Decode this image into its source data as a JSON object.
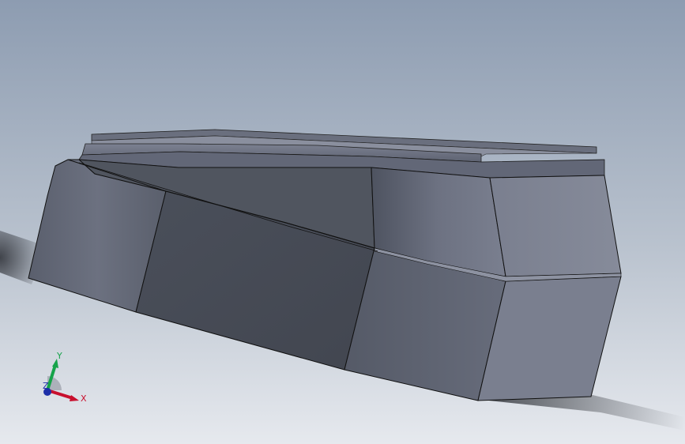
{
  "viewport": {
    "background_top": "#8c9bb0",
    "background_bottom": "#e4e8ed"
  },
  "triad": {
    "x_label": "X",
    "y_label": "Y",
    "z_label": "Z",
    "x_color": "#c8102e",
    "y_color": "#16a34a",
    "z_color": "#1d2fa8"
  },
  "model": {
    "face_color_dark": "#454a55",
    "face_color_mid": "#5c6170",
    "face_color_light": "#7f8494",
    "edge_color": "#111111"
  }
}
